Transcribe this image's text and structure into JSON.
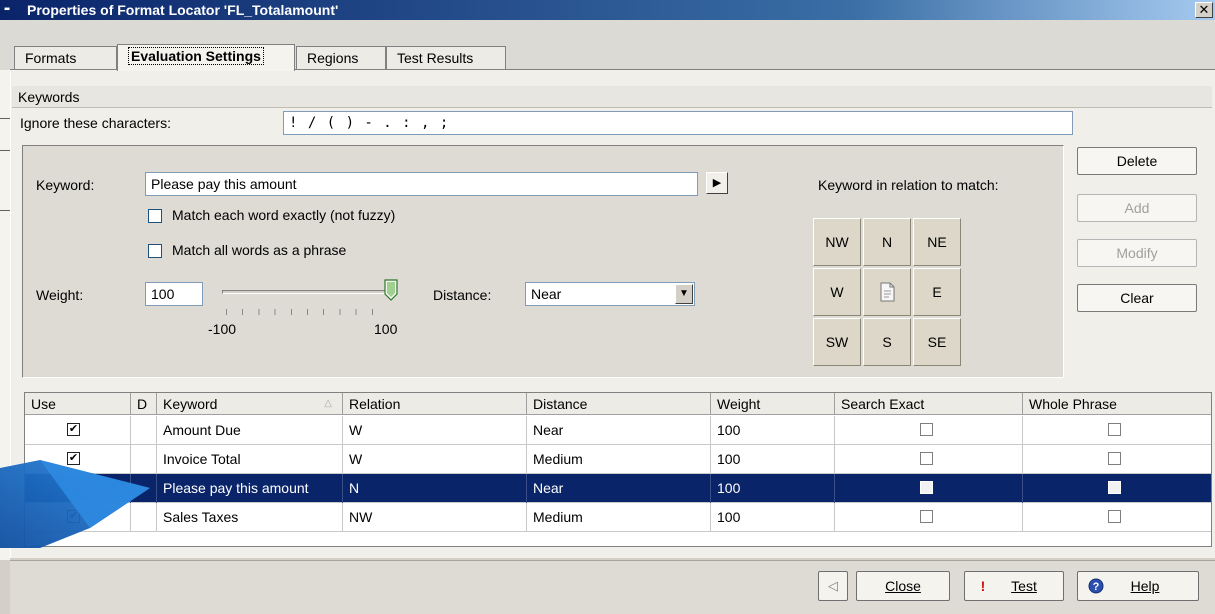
{
  "window": {
    "title": "Properties of Format Locator 'FL_Totalamount'",
    "close_label": "✕"
  },
  "tabs": [
    {
      "label": "Formats"
    },
    {
      "label": "Evaluation Settings"
    },
    {
      "label": "Regions"
    },
    {
      "label": "Test Results"
    }
  ],
  "keywords_section": {
    "header": "Keywords",
    "ignore_label": "Ignore these characters:",
    "ignore_value": "! / ( ) - . : , ;"
  },
  "editor": {
    "keyword_label": "Keyword:",
    "keyword_value": "Please pay this amount",
    "match_exact_label": "Match each word exactly (not fuzzy)",
    "match_exact_checked": false,
    "match_phrase_label": "Match all words as a phrase",
    "match_phrase_checked": false,
    "weight_label": "Weight:",
    "weight_value": "100",
    "slider_min_label": "-100",
    "slider_max_label": "100",
    "slider_value": 100,
    "distance_label": "Distance:",
    "distance_value": "Near",
    "relation_label": "Keyword in relation to match:",
    "relation_grid": [
      "NW",
      "N",
      "NE",
      "W",
      "",
      "E",
      "SW",
      "S",
      "SE"
    ]
  },
  "side_buttons": {
    "delete": "Delete",
    "add": "Add",
    "modify": "Modify",
    "clear": "Clear"
  },
  "table": {
    "columns": [
      "Use",
      "D",
      "Keyword",
      "Relation",
      "Distance",
      "Weight",
      "Search Exact",
      "Whole Phrase"
    ],
    "rows": [
      {
        "use": true,
        "keyword": "Amount Due",
        "relation": "W",
        "distance": "Near",
        "weight": "100",
        "search_exact": false,
        "whole_phrase": false,
        "selected": false
      },
      {
        "use": true,
        "keyword": "Invoice Total",
        "relation": "W",
        "distance": "Medium",
        "weight": "100",
        "search_exact": false,
        "whole_phrase": false,
        "selected": false
      },
      {
        "use": true,
        "keyword": "Please pay this amount",
        "relation": "N",
        "distance": "Near",
        "weight": "100",
        "search_exact": false,
        "whole_phrase": false,
        "selected": true
      },
      {
        "use": true,
        "keyword": "Sales Taxes",
        "relation": "NW",
        "distance": "Medium",
        "weight": "100",
        "search_exact": false,
        "whole_phrase": false,
        "selected": false
      }
    ]
  },
  "footer": {
    "close_label": "Close",
    "test_label": "Test",
    "help_label": "Help"
  },
  "colors": {
    "selection": "#0a246a",
    "title_gradient_start": "#0a246a",
    "callout_arrow": "#1f6fc6"
  },
  "icons": {
    "document": "document-icon",
    "arrow": "play-arrow-icon",
    "test": "exclamation-icon",
    "help": "help-icon",
    "back": "back-arrow-icon"
  }
}
